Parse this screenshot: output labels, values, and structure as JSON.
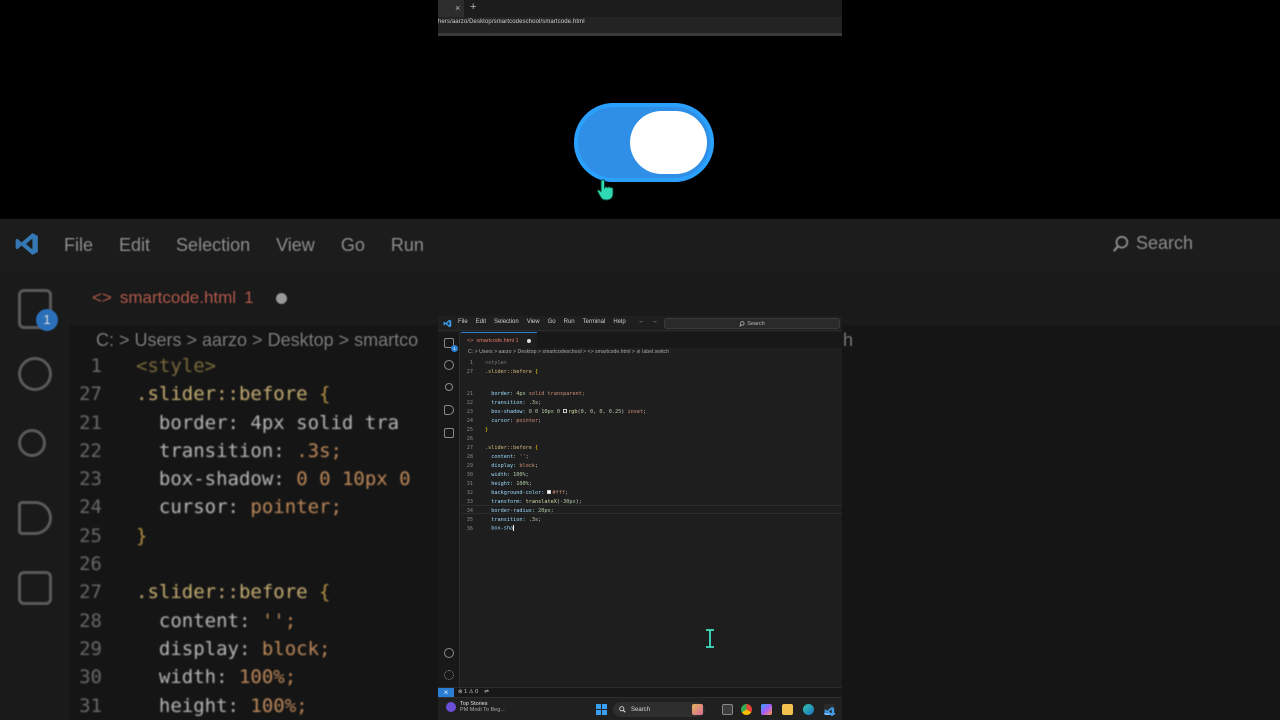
{
  "background": {
    "menu": [
      "File",
      "Edit",
      "Selection",
      "View",
      "Go",
      "Run"
    ],
    "search_label": "Search",
    "tab_label": "smartcode.html",
    "tab_badge": "1",
    "explorer_badge": "1",
    "breadcrumb": "C: > Users > aarzo > Desktop > smartco",
    "breadcrumb_right": "h",
    "code_lines": [
      {
        "n": "1",
        "html": "<span class='c-tag'>&lt;style&gt;</span>"
      },
      {
        "n": "27",
        "html": "<span class='c-sel'>.slider::before</span> <span class='c-br'>{</span>"
      },
      {
        "n": "21",
        "html": "  <span class='c-prop'>border: 4px solid tra</span>"
      },
      {
        "n": "22",
        "html": "  <span class='c-prop'>transition:</span> <span class='c-val'>.3s;</span>"
      },
      {
        "n": "23",
        "html": "  <span class='c-prop'>box-shadow:</span> <span class='c-val'>0 0 10px 0</span>"
      },
      {
        "n": "24",
        "html": "  <span class='c-prop'>cursor:</span> <span class='c-val'>pointer;</span>"
      },
      {
        "n": "25",
        "html": "<span class='c-br'>}</span>"
      },
      {
        "n": "26",
        "html": ""
      },
      {
        "n": "27",
        "html": "<span class='c-sel'>.slider::before</span> <span class='c-br'>{</span>"
      },
      {
        "n": "28",
        "html": "  <span class='c-prop'>content:</span> <span class='c-val'>'';</span>"
      },
      {
        "n": "29",
        "html": "  <span class='c-prop'>display:</span> <span class='c-val'>block;</span>"
      },
      {
        "n": "30",
        "html": "  <span class='c-prop'>width:</span> <span class='c-val'>100%;</span>"
      },
      {
        "n": "31",
        "html": "  <span class='c-prop'>height:</span> <span class='c-val'>100%;</span>"
      },
      {
        "n": "32",
        "html": "  <span class='c-prop'>background-color:</span>"
      }
    ]
  },
  "browser": {
    "url": "hers/aarzo/Desktop/smartcodeschool/smartcode.html",
    "close_glyph": "×",
    "new_tab_glyph": "+"
  },
  "toggle": {
    "state": "on",
    "track_color": "#2f8fe6",
    "knob_color": "#ffffff"
  },
  "vscode": {
    "menu": [
      "File",
      "Edit",
      "Selection",
      "View",
      "Go",
      "Run",
      "Terminal",
      "Help"
    ],
    "nav_back": "←",
    "nav_forward": "→",
    "search_placeholder": "Search",
    "explorer_badge": "1",
    "tab": {
      "label": "smartcode.html 1",
      "modified": true
    },
    "breadcrumb": "C: > Users > aarzo > Desktop > smartcodeschool > <> smartcode.html > ⊘ label.switch",
    "lines": [
      {
        "n": "1",
        "html": "<span class='k-tag'>&lt;style&gt;</span>"
      },
      {
        "n": "27",
        "html": "<span class='k-sel'>.slider::before</span> <span class='k-br'>{</span>"
      },
      {
        "n": "21",
        "html": "  <span class='k-prop'>border:</span> <span class='k-num'>4px</span> <span class='k-val'>solid transparent;</span>"
      },
      {
        "n": "22",
        "html": "  <span class='k-prop'>transition:</span> <span class='k-num'>.3s</span>;"
      },
      {
        "n": "23",
        "html": "  <span class='k-prop'>box-shadow:</span> <span class='k-num'>0 0 10px 0</span> <span class='swatch'></span><span class='k-fn'>rgb</span>(<span class='k-num'>0, 0, 0, 0.25</span>) <span class='k-val'>inset</span>;"
      },
      {
        "n": "24",
        "html": "  <span class='k-prop'>cursor:</span> <span class='k-val'>pointer</span>;"
      },
      {
        "n": "25",
        "html": "<span class='k-br'>}</span>"
      },
      {
        "n": "26",
        "html": ""
      },
      {
        "n": "27",
        "html": "<span class='k-sel'>.slider::before</span> <span class='k-br'>{</span>"
      },
      {
        "n": "28",
        "html": "  <span class='k-prop'>content:</span> <span class='k-val'>''</span>;"
      },
      {
        "n": "29",
        "html": "  <span class='k-prop'>display:</span> <span class='k-val'>block</span>;"
      },
      {
        "n": "30",
        "html": "  <span class='k-prop'>width:</span> <span class='k-num'>100%</span>;"
      },
      {
        "n": "31",
        "html": "  <span class='k-prop'>height:</span> <span class='k-num'>100%</span>;"
      },
      {
        "n": "32",
        "html": "  <span class='k-prop'>background-color:</span> <span class='swatch white'></span><span class='k-val'>#fff</span>;"
      },
      {
        "n": "33",
        "html": "  <span class='k-prop'>transform:</span> <span class='k-fn'>translateX</span>(<span class='k-num'>-30px</span>);"
      },
      {
        "n": "34",
        "html": "  <span class='k-prop'>border-radius:</span> <span class='k-num'>20px</span>;"
      },
      {
        "n": "35",
        "html": "  <span class='k-prop'>transition:</span> <span class='k-num'>.3s</span>;"
      },
      {
        "n": "36",
        "html": "  <span class='k-prop'>box-sha</span><span class='caret'></span>"
      }
    ],
    "status": {
      "remote": "⨯",
      "problems": "⊗ 1 ⚠ 0",
      "ports": "⇌"
    }
  },
  "taskbar": {
    "news_title": "Top Stories",
    "news_subtitle": "PM Modi To Beg...",
    "search_label": "Search",
    "apps": [
      "chrome-icon",
      "copilot-icon",
      "explorer-icon",
      "edge-icon",
      "vscode-icon"
    ]
  }
}
